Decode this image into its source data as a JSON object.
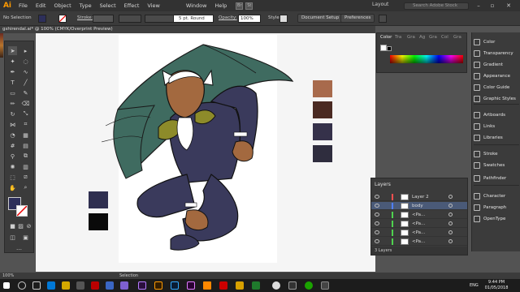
{
  "app": {
    "logo": "Ai"
  },
  "menu": {
    "items": [
      "File",
      "Edit",
      "Object",
      "Type",
      "Select",
      "Effect",
      "View",
      "Window",
      "Help"
    ],
    "br_label": "Br",
    "st_label": "St",
    "workspace": "Layout",
    "search_placeholder": "Search Adobe Stock"
  },
  "control_bar": {
    "selection": "No Selection",
    "stroke_label": "Stroke:",
    "brush": "5 pt. Round",
    "opacity_label": "Opacity:",
    "opacity_value": "100%",
    "style_label": "Style:",
    "doc_setup": "Document Setup",
    "preferences": "Preferences"
  },
  "document": {
    "tab_title": "gshirendal.ai* @ 100% (CMYK/Overprint Preview)"
  },
  "color_panel": {
    "tabs": [
      "Color",
      "Tra",
      "Gra",
      "Ag",
      "Gra",
      "Col",
      "Gra"
    ]
  },
  "dock": {
    "items": [
      {
        "label": "Color",
        "icon": "color-icon"
      },
      {
        "label": "Transparency",
        "icon": "transparency-icon"
      },
      {
        "label": "Gradient",
        "icon": "gradient-icon"
      },
      {
        "label": "Appearance",
        "icon": "appearance-icon"
      },
      {
        "label": "Color Guide",
        "icon": "color-guide-icon"
      },
      {
        "label": "Graphic Styles",
        "icon": "graphic-styles-icon"
      },
      {
        "label": "Artboards",
        "icon": "artboards-icon"
      },
      {
        "label": "Links",
        "icon": "links-icon"
      },
      {
        "label": "Libraries",
        "icon": "libraries-icon"
      },
      {
        "label": "Stroke",
        "icon": "stroke-icon"
      },
      {
        "label": "Swatches",
        "icon": "swatches-icon"
      },
      {
        "label": "Pathfinder",
        "icon": "pathfinder-icon"
      },
      {
        "label": "Character",
        "icon": "character-icon"
      },
      {
        "label": "Paragraph",
        "icon": "paragraph-icon"
      },
      {
        "label": "OpenType",
        "icon": "opentype-icon"
      }
    ]
  },
  "layers": {
    "title": "Layers",
    "rows": [
      {
        "name": "Layer 2",
        "color": "#ff4f4f"
      },
      {
        "name": "body",
        "color": "#4f7fff"
      },
      {
        "name": "<Pa...",
        "color": "#4fd24f"
      },
      {
        "name": "<Pa...",
        "color": "#4fd24f"
      },
      {
        "name": "<Pa...",
        "color": "#4fd24f"
      },
      {
        "name": "<Pa...",
        "color": "#4fd24f"
      }
    ],
    "footer": "3 Layers"
  },
  "canvas_swatches": {
    "colors": [
      "#a86a4c",
      "#4a2a22",
      "#35314a",
      "#2f2d3e",
      "#2f2f50",
      "#0a0a0a"
    ]
  },
  "status": {
    "zoom": "100%",
    "tool": "Selection"
  },
  "taskbar": {
    "time": "9:44 PM",
    "date": "01/05/2018",
    "lang": "ENG"
  },
  "colors": {
    "accent": "#ff9a00",
    "cape": "#3f6b60",
    "suit": "#3a3a5c",
    "skin": "#a3693f",
    "gold": "#8d8b2a"
  }
}
